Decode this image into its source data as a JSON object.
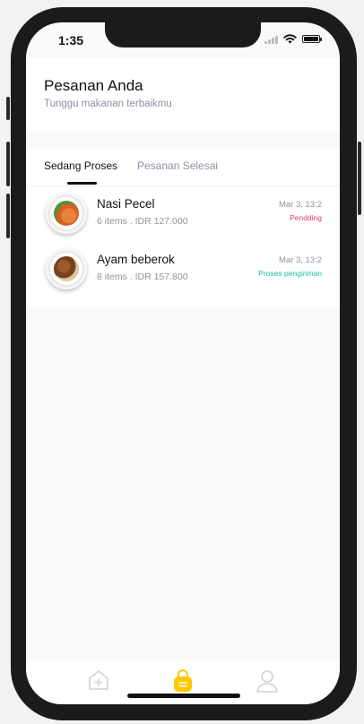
{
  "status_bar": {
    "time": "1:35"
  },
  "header": {
    "title": "Pesanan Anda",
    "subtitle": "Tunggu makanan terbaikmu"
  },
  "tabs": [
    {
      "label": "Sedang Proses",
      "active": true
    },
    {
      "label": "Pesanan Selesai",
      "active": false
    }
  ],
  "orders": [
    {
      "name": "Nasi Pecel",
      "meta": "6 items . IDR 127.000",
      "date": "Mar 3, 13:2",
      "status": "Pendding",
      "status_color": "#e53b5c"
    },
    {
      "name": "Ayam beberok",
      "meta": "8 items . IDR 157.800",
      "date": "Mar 3, 13:2",
      "status": "Proses pengiriman",
      "status_color": "#1abc9c"
    }
  ],
  "bottom_nav": [
    {
      "icon": "home-plus-icon",
      "active": false
    },
    {
      "icon": "order-bag-icon",
      "active": true,
      "color": "#ffc700"
    },
    {
      "icon": "profile-icon",
      "active": false
    }
  ]
}
